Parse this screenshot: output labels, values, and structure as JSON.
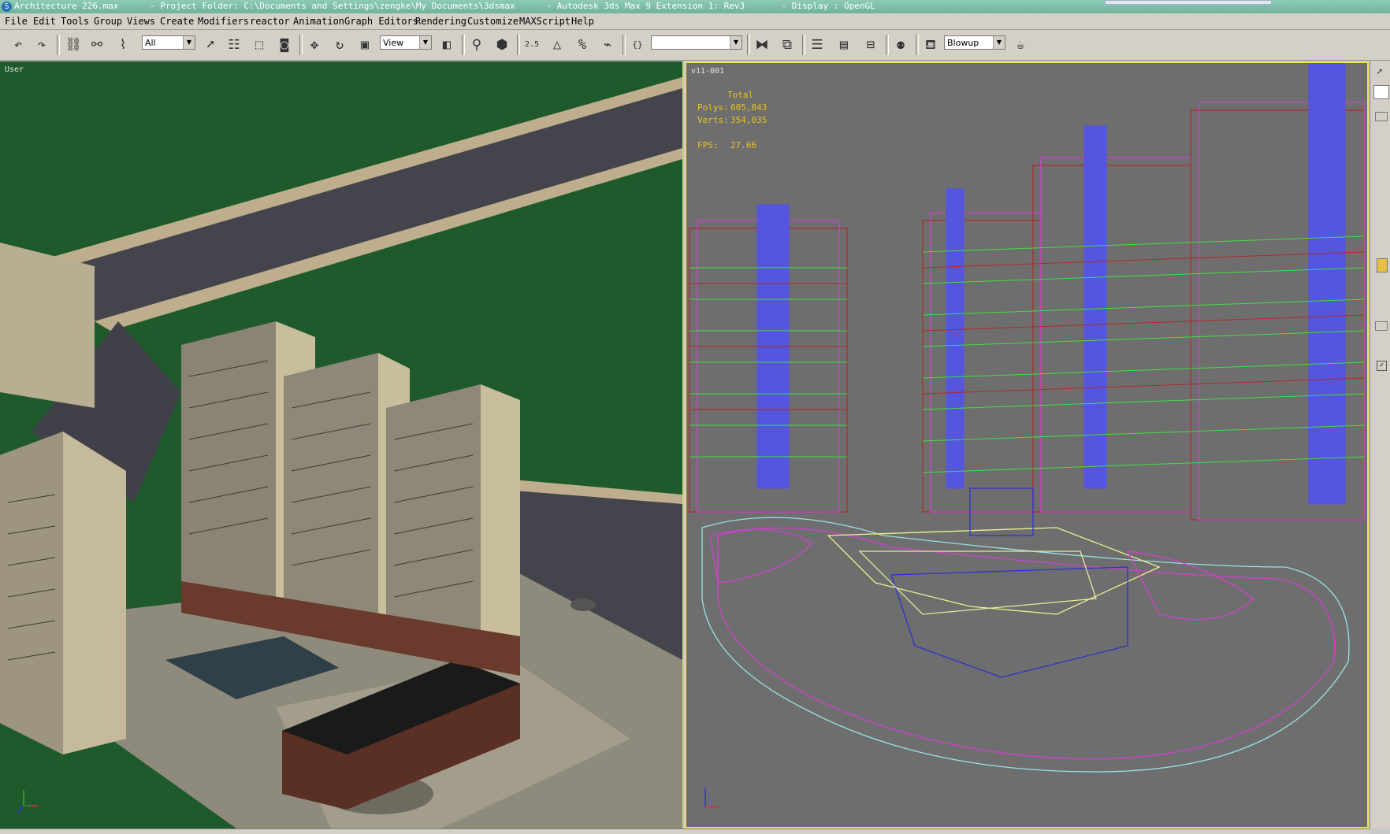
{
  "titlebar": {
    "app_title": "Architecture 226.max      - Project Folder: C:\\Documents and Settings\\zengke\\My Documents\\3dsmax      - Autodesk 3ds Max 9 Extension 1: Rev3       - Display : OpenGL",
    "app_icon": "3ds-max-icon"
  },
  "menubar": {
    "items": [
      "File",
      "Edit",
      "Tools",
      "Group",
      "Views",
      "Create",
      "Modifiers",
      "reactor",
      "Animation",
      "Graph Editors",
      "Rendering",
      "Customize",
      "MAXScript",
      "Help"
    ]
  },
  "toolbar": {
    "selection_filter": "All",
    "reference_coord": "View",
    "named_selection": "",
    "render_preset": "Blowup",
    "angle_snap_label": "2.5"
  },
  "viewports": {
    "left": {
      "label": "User"
    },
    "right": {
      "label": "v11-001",
      "stats_header": "Total",
      "polys_label": "Polys:",
      "polys_value": "605,843",
      "verts_label": "Verts:",
      "verts_value": "354,035",
      "fps_label": "FPS:",
      "fps_value": "27.66"
    }
  },
  "colors": {
    "title_bg": "#7dbfa8",
    "ui_gray": "#d4d0c8",
    "viewport_gray": "#6e6e6e",
    "active_border": "#f0e050",
    "stats_text": "#e6c420"
  }
}
